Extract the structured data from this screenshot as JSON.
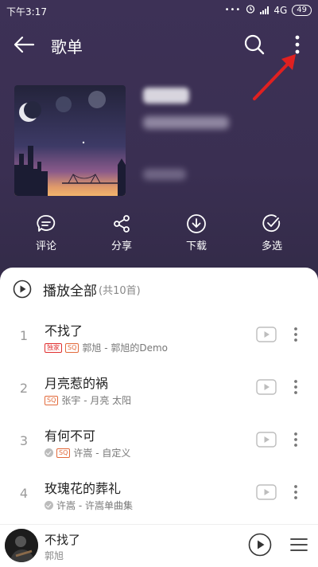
{
  "status_bar": {
    "time": "下午3:17",
    "network": "4G",
    "battery": "49"
  },
  "header": {
    "title": "歌单"
  },
  "actions": [
    {
      "label": "评论",
      "icon": "comment-icon"
    },
    {
      "label": "分享",
      "icon": "share-icon"
    },
    {
      "label": "下载",
      "icon": "download-icon"
    },
    {
      "label": "多选",
      "icon": "multiselect-icon"
    }
  ],
  "playlist": {
    "play_all_label": "播放全部",
    "count_label": "(共10首)",
    "songs": [
      {
        "num": "1",
        "name": "不找了",
        "tags": [
          "独家",
          "SQ"
        ],
        "artist": "郭旭 - 郭旭的Demo"
      },
      {
        "num": "2",
        "name": "月亮惹的祸",
        "tags": [
          "SQ"
        ],
        "artist": "张宇 - 月亮 太阳"
      },
      {
        "num": "3",
        "name": "有何不可",
        "tags": [
          "SQ"
        ],
        "artist": "许嵩 - 自定义"
      },
      {
        "num": "4",
        "name": "玫瑰花的葬礼",
        "tags": [],
        "artist": "许嵩 - 许嵩单曲集"
      }
    ]
  },
  "player": {
    "title": "不找了",
    "artist": "郭旭"
  },
  "colors": {
    "accent": "#e02e2e",
    "annotation_arrow": "#e02020"
  }
}
